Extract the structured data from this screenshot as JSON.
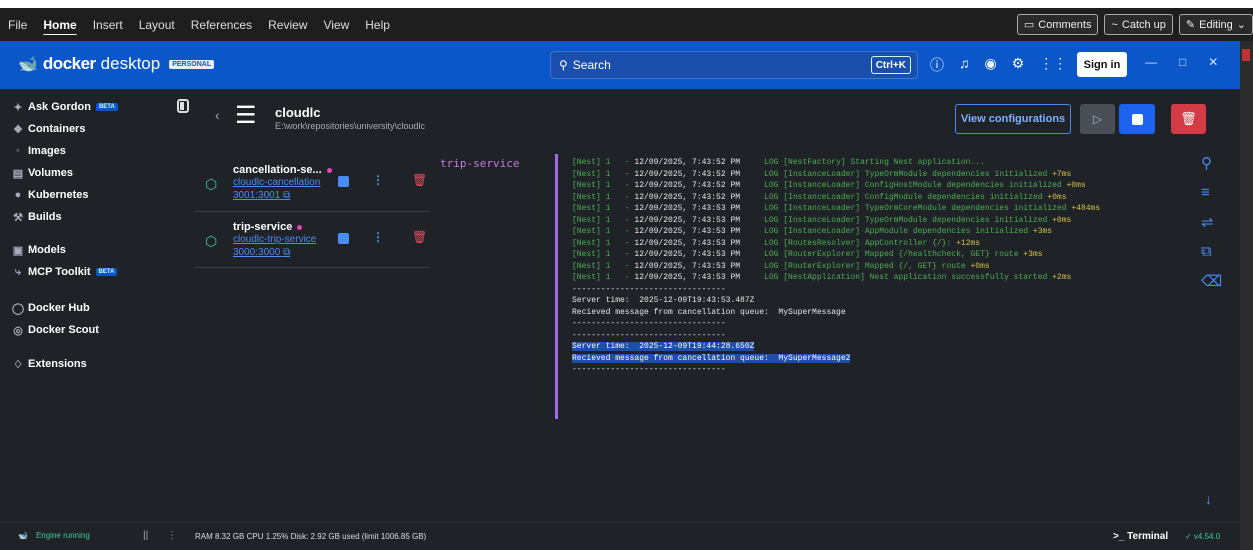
{
  "menubar": {
    "items": [
      "File",
      "Home",
      "Insert",
      "Layout",
      "References",
      "Review",
      "View",
      "Help"
    ],
    "comments": "Comments",
    "catch_up": "Catch up",
    "editing": "Editing"
  },
  "titlebar": {
    "brand": "docker",
    "brand2": "desktop",
    "plan": "PERSONAL",
    "search_placeholder": "Search",
    "shortcut": "Ctrl+K",
    "sign_in": "Sign in"
  },
  "sidebar": {
    "items": [
      {
        "label": "Ask Gordon",
        "badge": "BETA",
        "icon": "sparkle-icon"
      },
      {
        "label": "Containers",
        "badge": "",
        "icon": "containers-icon"
      },
      {
        "label": "Images",
        "badge": "",
        "icon": "images-icon"
      },
      {
        "label": "Volumes",
        "badge": "",
        "icon": "volumes-icon"
      },
      {
        "label": "Kubernetes",
        "badge": "",
        "icon": "kubernetes-icon"
      },
      {
        "label": "Builds",
        "badge": "",
        "icon": "builds-icon"
      },
      {
        "label": "Models",
        "badge": "",
        "icon": "models-icon"
      },
      {
        "label": "MCP Toolkit",
        "badge": "BETA",
        "icon": "mcp-icon"
      },
      {
        "label": "Docker Hub",
        "badge": "",
        "icon": "hub-icon"
      },
      {
        "label": "Docker Scout",
        "badge": "",
        "icon": "scout-icon"
      },
      {
        "label": "Extensions",
        "badge": "",
        "icon": "extensions-icon"
      }
    ]
  },
  "project": {
    "name": "cloudlc",
    "path": "E:\\work\\repositories\\university\\cloudlc",
    "view_configurations": "View configurations"
  },
  "services": [
    {
      "name": "cancellation-se...",
      "container": "cloudlc-cancellation",
      "ports": "3001:3001"
    },
    {
      "name": "trip-service",
      "container": "cloudlc-trip-service",
      "ports": "3000:3000"
    }
  ],
  "logs": {
    "service_label": "trip-service",
    "lines": [
      {
        "prefix": "[Nest] 1   - ",
        "ts": "12/09/2025, 7:43:52 PM",
        "msg": "     LOG [NestFactory] Starting Nest application...",
        "extra": ""
      },
      {
        "prefix": "[Nest] 1   - ",
        "ts": "12/09/2025, 7:43:52 PM",
        "msg": "     LOG [InstanceLoader] TypeOrmModule dependencies initialized ",
        "extra": "+7ms"
      },
      {
        "prefix": "[Nest] 1   - ",
        "ts": "12/09/2025, 7:43:52 PM",
        "msg": "     LOG [InstanceLoader] ConfigHostModule dependencies initialized ",
        "extra": "+0ms"
      },
      {
        "prefix": "[Nest] 1   - ",
        "ts": "12/09/2025, 7:43:52 PM",
        "msg": "     LOG [InstanceLoader] ConfigModule dependencies initialized ",
        "extra": "+0ms"
      },
      {
        "prefix": "[Nest] 1   - ",
        "ts": "12/09/2025, 7:43:53 PM",
        "msg": "     LOG [InstanceLoader] TypeOrmCoreModule dependencies initialized ",
        "extra": "+484ms"
      },
      {
        "prefix": "[Nest] 1   - ",
        "ts": "12/09/2025, 7:43:53 PM",
        "msg": "     LOG [InstanceLoader] TypeOrmModule dependencies initialized ",
        "extra": "+0ms"
      },
      {
        "prefix": "[Nest] 1   - ",
        "ts": "12/09/2025, 7:43:53 PM",
        "msg": "     LOG [InstanceLoader] AppModule dependencies initialized ",
        "extra": "+3ms"
      },
      {
        "prefix": "[Nest] 1   - ",
        "ts": "12/09/2025, 7:43:53 PM",
        "msg": "     LOG [RoutesResolver] AppController {/}: ",
        "extra": "+12ms"
      },
      {
        "prefix": "[Nest] 1   - ",
        "ts": "12/09/2025, 7:43:53 PM",
        "msg": "     LOG [RouterExplorer] Mapped {/healthcheck, GET} route ",
        "extra": "+3ms"
      },
      {
        "prefix": "[Nest] 1   - ",
        "ts": "12/09/2025, 7:43:53 PM",
        "msg": "     LOG [RouterExplorer] Mapped {/, GET} route ",
        "extra": "+0ms"
      },
      {
        "prefix": "[Nest] 1   - ",
        "ts": "12/09/2025, 7:43:53 PM",
        "msg": "     LOG [NestApplication] Nest application successfully started ",
        "extra": "+2ms"
      }
    ],
    "plain": [
      "--------------------------------",
      "Server time:  2025-12-09T19:43:53.487Z",
      "Recieved message from cancellation queue:  MySuperMessage",
      "--------------------------------",
      "--------------------------------",
      "Server time:  2025-12-09T19:44:28.650Z",
      "Recieved message from cancellation queue:  MySuperMessage2",
      "--------------------------------"
    ]
  },
  "statusbar": {
    "engine": "Engine running",
    "resources": "RAM 8.32 GB  CPU 1.25%   Disk: 2.92 GB used (limit 1006.85 GB)",
    "terminal": ">_ Terminal",
    "version": "✓ v4.54.0"
  }
}
